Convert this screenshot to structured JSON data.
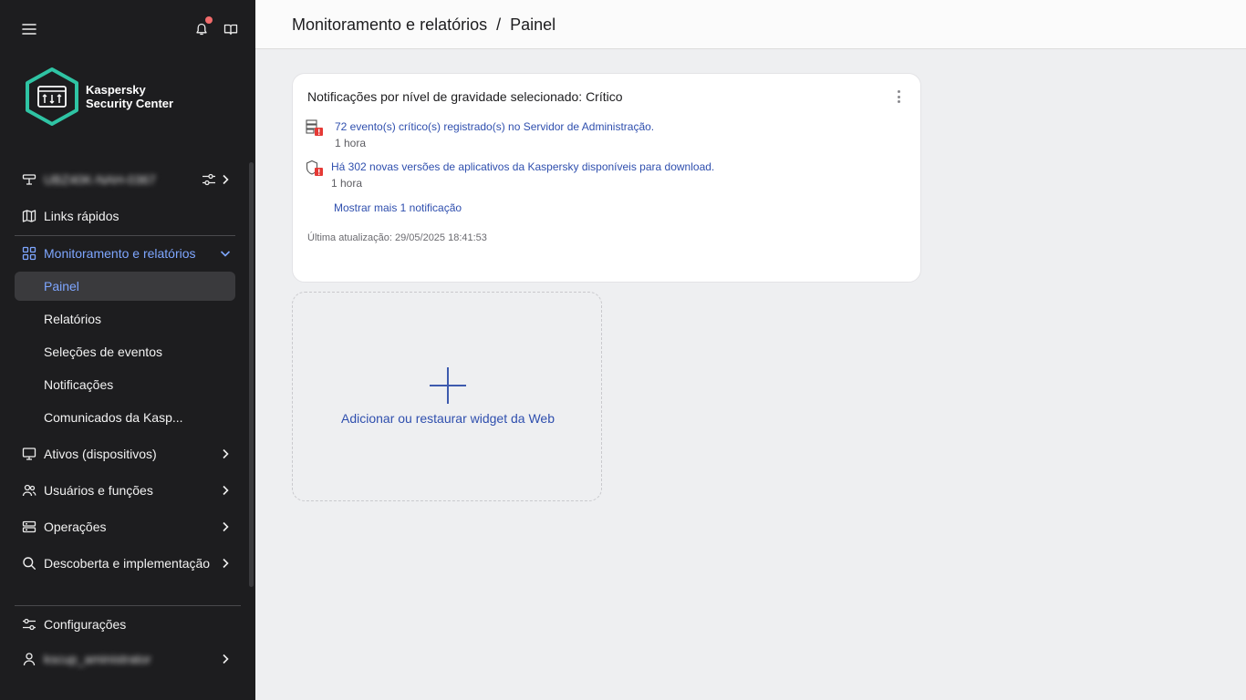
{
  "sidebar": {
    "logo": {
      "line1": "Kaspersky",
      "line2": "Security Center"
    },
    "server": {
      "name": "UBZ40K-NAH-0367"
    },
    "quick_links": "Links rápidos",
    "monitoring": "Monitoramento e relatórios",
    "sub_items": [
      {
        "label": "Painel",
        "active": true
      },
      {
        "label": "Relatórios"
      },
      {
        "label": "Seleções de eventos"
      },
      {
        "label": "Notificações"
      },
      {
        "label": "Comunicados da Kasp..."
      }
    ],
    "items": [
      {
        "label": "Ativos (dispositivos)",
        "icon": "monitor-icon"
      },
      {
        "label": "Usuários e funções",
        "icon": "users-icon"
      },
      {
        "label": "Operações",
        "icon": "server-icon"
      },
      {
        "label": "Descoberta e implementação",
        "icon": "search-icon"
      }
    ],
    "settings": "Configurações",
    "user": {
      "name": "kscup_aministrator"
    },
    "colors": {
      "background": "#1d1d1f",
      "accent": "#7ea6ff"
    }
  },
  "header": {
    "section": "Monitoramento e relatórios",
    "separator": "/",
    "page": "Painel"
  },
  "widget": {
    "title": "Notificações por nível de gravidade selecionado: Crítico",
    "notifications": [
      {
        "text": "72 evento(s) crítico(s) registrado(s) no Servidor de Administração.",
        "time": "1 hora",
        "icon": "server-alert-icon"
      },
      {
        "text": "Há 302 novas versões de aplicativos da Kaspersky disponíveis para download.",
        "time": "1 hora",
        "icon": "shield-alert-icon"
      }
    ],
    "more": "Mostrar mais 1 notificação",
    "updated": "Última atualização: 29/05/2025 18:41:53"
  },
  "add_widget": {
    "label": "Adicionar ou restaurar widget da Web"
  }
}
